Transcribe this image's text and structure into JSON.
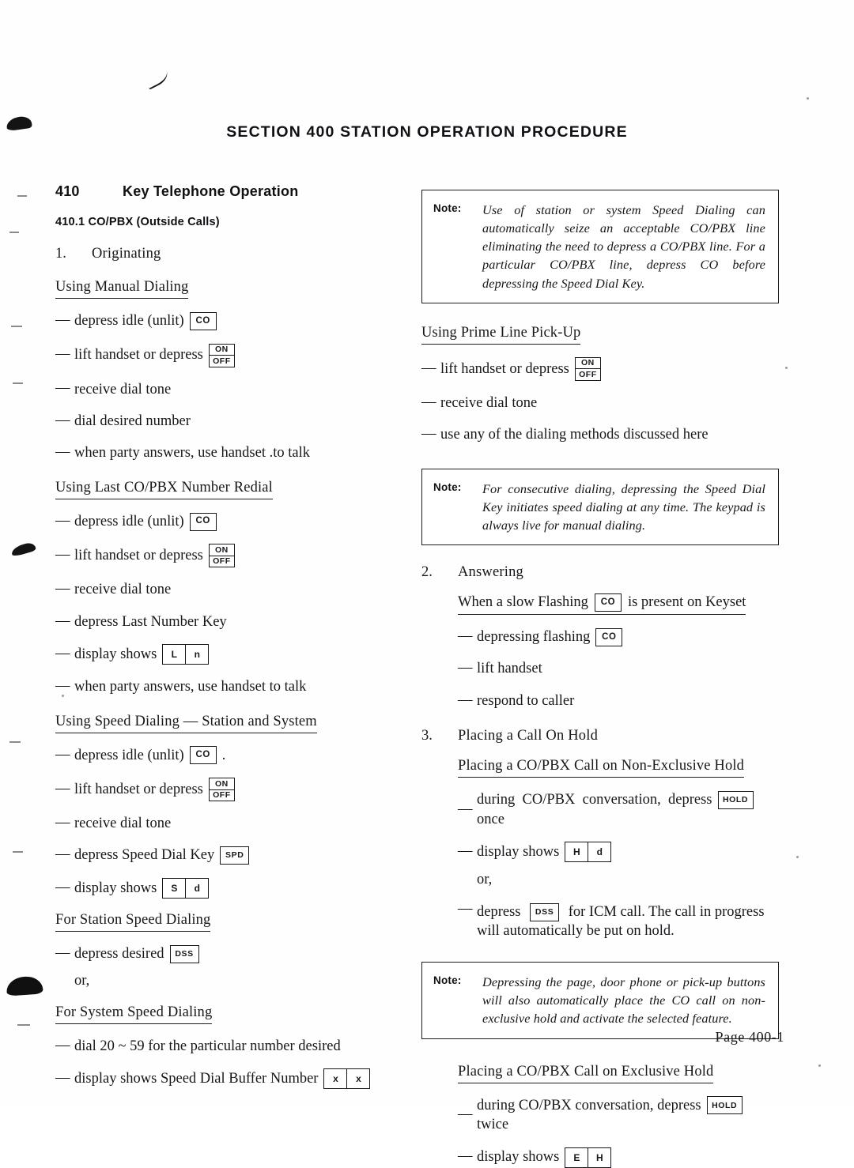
{
  "document": {
    "title": "SECTION 400   STATION OPERATION PROCEDURE",
    "page_footer": "Page  400-1"
  },
  "left_column": {
    "section_number": "410",
    "section_title": "Key Telephone Operation",
    "subsection": "410.1  CO/PBX (Outside Calls)",
    "item1_number": "1.",
    "item1_title": "Originating",
    "manual_dialing": {
      "heading": "Using Manual Dialing",
      "steps": [
        "depress idle (unlit)",
        "lift handset or depress",
        "receive dial tone",
        "dial desired number",
        "when party answers, use handset .to talk"
      ]
    },
    "last_number_redial": {
      "heading": "Using Last CO/PBX Number Redial",
      "steps": [
        "depress idle (unlit)",
        "lift handset or depress",
        "receive dial tone",
        "depress Last Number Key",
        "display shows",
        "when party answers, use handset to talk"
      ],
      "display_cells": [
        "L",
        "n"
      ]
    },
    "speed_dialing": {
      "heading": "Using Speed Dialing — Station and System",
      "steps": [
        "depress idle (unlit)",
        "lift handset or depress",
        "receive dial tone",
        "depress Speed Dial Key",
        "display shows"
      ],
      "trailing_period": ".",
      "display_cells": [
        "S",
        "d"
      ]
    },
    "station_speed_dialing": {
      "heading": "For Station Speed Dialing",
      "step": "depress desired",
      "or_text": "or,"
    },
    "system_speed_dialing": {
      "heading": "For System Speed Dialing",
      "steps": [
        "dial 20 ~ 59 for the particular number desired",
        "display shows Speed Dial Buffer Number"
      ],
      "display_cells": [
        "x",
        "x"
      ]
    }
  },
  "right_column": {
    "note1": {
      "label": "Note:",
      "text": "Use of station or system Speed Dialing can automatically seize an acceptable CO/PBX line eliminating the need to depress a CO/PBX line. For a particular CO/PBX line, depress CO before depressing the Speed Dial Key."
    },
    "prime_line": {
      "heading": "Using Prime Line Pick-Up",
      "steps": [
        "lift handset or depress",
        "receive dial tone",
        "use any of the dialing methods discussed here"
      ]
    },
    "note2": {
      "label": "Note:",
      "text": "For consecutive dialing, depressing the Speed Dial Key initiates speed dialing at any time. The keypad is always live for manual dialing."
    },
    "item2_number": "2.",
    "item2_title": "Answering",
    "answering": {
      "heading_before": "When a slow Flashing",
      "heading_after": "is present on Keyset",
      "steps": [
        "depressing flashing",
        "lift handset",
        "respond to caller"
      ]
    },
    "item3_number": "3.",
    "item3_title": "Placing a Call On Hold",
    "non_exclusive_hold": {
      "heading": "Placing a CO/PBX Call on Non-Exclusive Hold",
      "step1_before": "during  CO/PBX  conversation,  depress",
      "step1_after": "once",
      "step2": "display shows",
      "display_cells": [
        "H",
        "d"
      ],
      "or_text": "or,",
      "step3_before": "depress",
      "step3_after": "for ICM call.  The call in progress will automatically be put on hold."
    },
    "note3": {
      "label": "Note:",
      "text": "Depressing the page, door phone or pick-up buttons will also automatically place the CO call on non-exclusive hold and activate the selected feature."
    },
    "exclusive_hold": {
      "heading": "Placing a CO/PBX Call on Exclusive Hold",
      "step1_before": "during CO/PBX conversation, depress",
      "step1_after": "twice",
      "step2": "display shows",
      "display_cells": [
        "E",
        "H"
      ]
    }
  },
  "keys": {
    "co": "CO",
    "on": "ON",
    "off": "OFF",
    "spd": "SPD",
    "dss": "DSS",
    "hold": "HOLD"
  },
  "colors": {
    "ink": "#16171a",
    "paper": "#fefefe",
    "rule": "#1b1c1f"
  }
}
